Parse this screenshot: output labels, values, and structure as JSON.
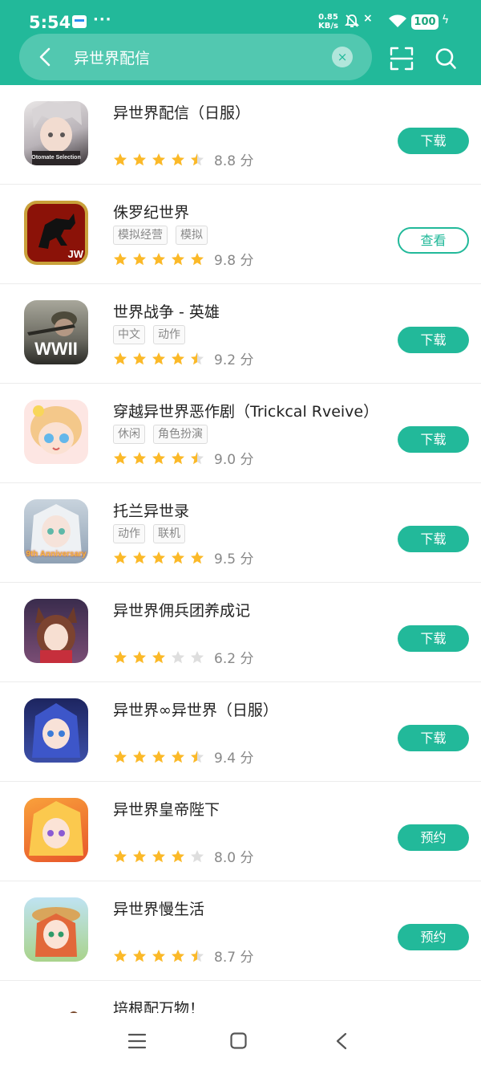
{
  "status_bar": {
    "time": "5:54",
    "more": "···",
    "net_speed": "0.85",
    "net_unit": "KB/s",
    "signal": "×",
    "battery": "100",
    "bolt": "ϟ"
  },
  "search": {
    "query": "异世界配信",
    "clear": "×"
  },
  "colors": {
    "accent": "#22b99a",
    "star": "#fbb928",
    "star_empty": "#dedede"
  },
  "apps": [
    {
      "name": "异世界配信（日服）",
      "tags": [],
      "rating": 4.5,
      "score": "8.8 分",
      "action": "下载",
      "icon_label": "Otomate Selection"
    },
    {
      "name": "侏罗纪世界",
      "tags": [
        "模拟经营",
        "模拟"
      ],
      "rating": 5,
      "score": "9.8 分",
      "action": "查看",
      "icon_label": "JW"
    },
    {
      "name": "世界战争 - 英雄",
      "tags": [
        "中文",
        "动作"
      ],
      "rating": 4.5,
      "score": "9.2 分",
      "action": "下载",
      "icon_label": "WWII"
    },
    {
      "name": "穿越异世界恶作剧（Trickcal Rveive）",
      "tags": [
        "休闲",
        "角色扮演"
      ],
      "rating": 4.5,
      "score": "9.0 分",
      "action": "下载",
      "icon_label": ""
    },
    {
      "name": "托兰异世录",
      "tags": [
        "动作",
        "联机"
      ],
      "rating": 5,
      "score": "9.5 分",
      "action": "下载",
      "icon_label": "9th Anniversary"
    },
    {
      "name": "异世界佣兵团养成记",
      "tags": [],
      "rating": 3,
      "score": "6.2 分",
      "action": "下载",
      "icon_label": ""
    },
    {
      "name": "异世界∞异世界（日服）",
      "tags": [],
      "rating": 4.5,
      "score": "9.4 分",
      "action": "下载",
      "icon_label": ""
    },
    {
      "name": "异世界皇帝陛下",
      "tags": [],
      "rating": 4,
      "score": "8.0 分",
      "action": "预约",
      "icon_label": ""
    },
    {
      "name": "异世界慢生活",
      "tags": [],
      "rating": 4.5,
      "score": "8.7 分",
      "action": "预约",
      "icon_label": ""
    },
    {
      "name": "培根配万物！",
      "tags": [],
      "rating": null,
      "score": "",
      "action": "",
      "icon_label": ""
    }
  ]
}
